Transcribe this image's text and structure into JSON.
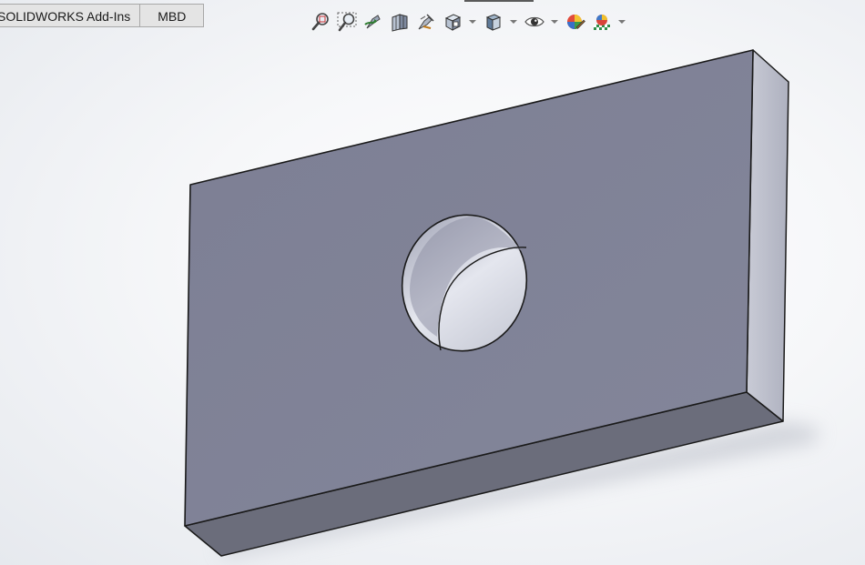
{
  "command_manager": {
    "tabs": [
      {
        "label": "SOLIDWORKS Add-Ins"
      },
      {
        "label": "MBD"
      }
    ]
  },
  "heads_up_toolbar": {
    "tools": [
      {
        "icon": "zoom-to-fit-icon"
      },
      {
        "icon": "zoom-to-area-icon"
      },
      {
        "icon": "previous-view-icon"
      },
      {
        "icon": "section-view-icon"
      },
      {
        "icon": "dynamic-annotation-views-icon"
      },
      {
        "icon": "view-orientation-icon"
      },
      {
        "icon": "display-style-icon"
      },
      {
        "icon": "hide-show-items-icon"
      },
      {
        "icon": "edit-appearance-icon"
      },
      {
        "icon": "apply-scene-icon"
      }
    ]
  },
  "model": {
    "shape": "rectangular plate with through hole",
    "face_color": "#7f8296",
    "edge_color": "#1a1a1a"
  }
}
